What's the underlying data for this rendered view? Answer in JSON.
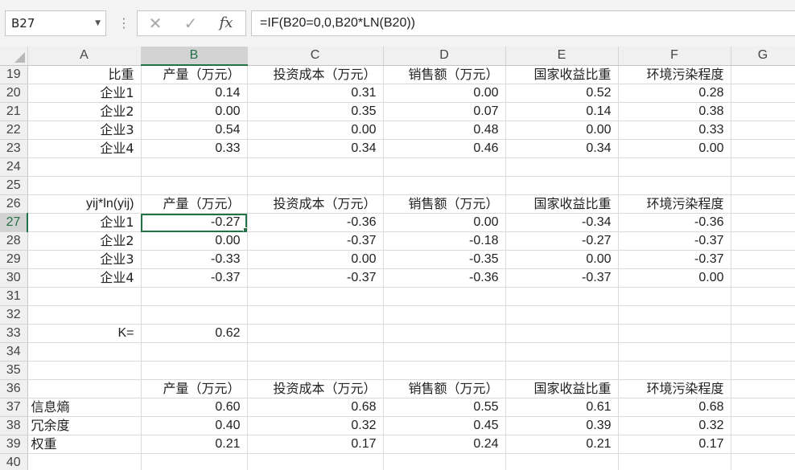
{
  "formula_bar": {
    "name_box": "B27",
    "formula": "=IF(B20=0,0,B20*LN(B20))",
    "cancel_icon": "✕",
    "enter_icon": "✓",
    "fx_label": "fx",
    "dots": "⋮"
  },
  "sheet": {
    "active_cell": "B27",
    "columns": [
      "A",
      "B",
      "C",
      "D",
      "E",
      "F",
      "G"
    ],
    "rows": [
      {
        "num": "19",
        "cells": [
          {
            "v": "比重",
            "a": "t"
          },
          {
            "v": "产量（万元）",
            "a": "t"
          },
          {
            "v": "投资成本（万元）",
            "a": "t"
          },
          {
            "v": "销售额（万元）",
            "a": "t"
          },
          {
            "v": "国家收益比重",
            "a": "t"
          },
          {
            "v": "环境污染程度",
            "a": "t"
          },
          {
            "v": "",
            "a": "e"
          }
        ]
      },
      {
        "num": "20",
        "cells": [
          {
            "v": "企业1",
            "a": "t"
          },
          {
            "v": "0.14",
            "a": "n"
          },
          {
            "v": "0.31",
            "a": "n"
          },
          {
            "v": "0.00",
            "a": "n"
          },
          {
            "v": "0.52",
            "a": "n"
          },
          {
            "v": "0.28",
            "a": "n"
          },
          {
            "v": "",
            "a": "e"
          }
        ]
      },
      {
        "num": "21",
        "cells": [
          {
            "v": "企业2",
            "a": "t"
          },
          {
            "v": "0.00",
            "a": "n"
          },
          {
            "v": "0.35",
            "a": "n"
          },
          {
            "v": "0.07",
            "a": "n"
          },
          {
            "v": "0.14",
            "a": "n"
          },
          {
            "v": "0.38",
            "a": "n"
          },
          {
            "v": "",
            "a": "e"
          }
        ]
      },
      {
        "num": "22",
        "cells": [
          {
            "v": "企业3",
            "a": "t"
          },
          {
            "v": "0.54",
            "a": "n"
          },
          {
            "v": "0.00",
            "a": "n"
          },
          {
            "v": "0.48",
            "a": "n"
          },
          {
            "v": "0.00",
            "a": "n"
          },
          {
            "v": "0.33",
            "a": "n"
          },
          {
            "v": "",
            "a": "e"
          }
        ]
      },
      {
        "num": "23",
        "cells": [
          {
            "v": "企业4",
            "a": "t"
          },
          {
            "v": "0.33",
            "a": "n"
          },
          {
            "v": "0.34",
            "a": "n"
          },
          {
            "v": "0.46",
            "a": "n"
          },
          {
            "v": "0.34",
            "a": "n"
          },
          {
            "v": "0.00",
            "a": "n"
          },
          {
            "v": "",
            "a": "e"
          }
        ]
      },
      {
        "num": "24",
        "cells": [
          {
            "v": "",
            "a": "e"
          },
          {
            "v": "",
            "a": "e"
          },
          {
            "v": "",
            "a": "e"
          },
          {
            "v": "",
            "a": "e"
          },
          {
            "v": "",
            "a": "e"
          },
          {
            "v": "",
            "a": "e"
          },
          {
            "v": "",
            "a": "e"
          }
        ]
      },
      {
        "num": "25",
        "cells": [
          {
            "v": "",
            "a": "e"
          },
          {
            "v": "",
            "a": "e"
          },
          {
            "v": "",
            "a": "e"
          },
          {
            "v": "",
            "a": "e"
          },
          {
            "v": "",
            "a": "e"
          },
          {
            "v": "",
            "a": "e"
          },
          {
            "v": "",
            "a": "e"
          }
        ]
      },
      {
        "num": "26",
        "cells": [
          {
            "v": "yij*ln(yij)",
            "a": "n"
          },
          {
            "v": "产量（万元）",
            "a": "t"
          },
          {
            "v": "投资成本（万元）",
            "a": "t"
          },
          {
            "v": "销售额（万元）",
            "a": "t"
          },
          {
            "v": "国家收益比重",
            "a": "t"
          },
          {
            "v": "环境污染程度",
            "a": "t"
          },
          {
            "v": "",
            "a": "e"
          }
        ]
      },
      {
        "num": "27",
        "cells": [
          {
            "v": "企业1",
            "a": "t"
          },
          {
            "v": "-0.27",
            "a": "n"
          },
          {
            "v": "-0.36",
            "a": "n"
          },
          {
            "v": "0.00",
            "a": "n"
          },
          {
            "v": "-0.34",
            "a": "n"
          },
          {
            "v": "-0.36",
            "a": "n"
          },
          {
            "v": "",
            "a": "e"
          }
        ]
      },
      {
        "num": "28",
        "cells": [
          {
            "v": "企业2",
            "a": "t"
          },
          {
            "v": "0.00",
            "a": "n"
          },
          {
            "v": "-0.37",
            "a": "n"
          },
          {
            "v": "-0.18",
            "a": "n"
          },
          {
            "v": "-0.27",
            "a": "n"
          },
          {
            "v": "-0.37",
            "a": "n"
          },
          {
            "v": "",
            "a": "e"
          }
        ]
      },
      {
        "num": "29",
        "cells": [
          {
            "v": "企业3",
            "a": "t"
          },
          {
            "v": "-0.33",
            "a": "n"
          },
          {
            "v": "0.00",
            "a": "n"
          },
          {
            "v": "-0.35",
            "a": "n"
          },
          {
            "v": "0.00",
            "a": "n"
          },
          {
            "v": "-0.37",
            "a": "n"
          },
          {
            "v": "",
            "a": "e"
          }
        ]
      },
      {
        "num": "30",
        "cells": [
          {
            "v": "企业4",
            "a": "t"
          },
          {
            "v": "-0.37",
            "a": "n"
          },
          {
            "v": "-0.37",
            "a": "n"
          },
          {
            "v": "-0.36",
            "a": "n"
          },
          {
            "v": "-0.37",
            "a": "n"
          },
          {
            "v": "0.00",
            "a": "n"
          },
          {
            "v": "",
            "a": "e"
          }
        ]
      },
      {
        "num": "31",
        "cells": [
          {
            "v": "",
            "a": "e"
          },
          {
            "v": "",
            "a": "e"
          },
          {
            "v": "",
            "a": "e"
          },
          {
            "v": "",
            "a": "e"
          },
          {
            "v": "",
            "a": "e"
          },
          {
            "v": "",
            "a": "e"
          },
          {
            "v": "",
            "a": "e"
          }
        ]
      },
      {
        "num": "32",
        "cells": [
          {
            "v": "",
            "a": "e"
          },
          {
            "v": "",
            "a": "e"
          },
          {
            "v": "",
            "a": "e"
          },
          {
            "v": "",
            "a": "e"
          },
          {
            "v": "",
            "a": "e"
          },
          {
            "v": "",
            "a": "e"
          },
          {
            "v": "",
            "a": "e"
          }
        ]
      },
      {
        "num": "33",
        "cells": [
          {
            "v": "K=",
            "a": "n"
          },
          {
            "v": "0.62",
            "a": "n"
          },
          {
            "v": "",
            "a": "e"
          },
          {
            "v": "",
            "a": "e"
          },
          {
            "v": "",
            "a": "e"
          },
          {
            "v": "",
            "a": "e"
          },
          {
            "v": "",
            "a": "e"
          }
        ]
      },
      {
        "num": "34",
        "cells": [
          {
            "v": "",
            "a": "e"
          },
          {
            "v": "",
            "a": "e"
          },
          {
            "v": "",
            "a": "e"
          },
          {
            "v": "",
            "a": "e"
          },
          {
            "v": "",
            "a": "e"
          },
          {
            "v": "",
            "a": "e"
          },
          {
            "v": "",
            "a": "e"
          }
        ]
      },
      {
        "num": "35",
        "cells": [
          {
            "v": "",
            "a": "e"
          },
          {
            "v": "",
            "a": "e"
          },
          {
            "v": "",
            "a": "e"
          },
          {
            "v": "",
            "a": "e"
          },
          {
            "v": "",
            "a": "e"
          },
          {
            "v": "",
            "a": "e"
          },
          {
            "v": "",
            "a": "e"
          }
        ]
      },
      {
        "num": "36",
        "cells": [
          {
            "v": "",
            "a": "e"
          },
          {
            "v": "产量（万元）",
            "a": "t"
          },
          {
            "v": "投资成本（万元）",
            "a": "t"
          },
          {
            "v": "销售额（万元）",
            "a": "t"
          },
          {
            "v": "国家收益比重",
            "a": "t"
          },
          {
            "v": "环境污染程度",
            "a": "t"
          },
          {
            "v": "",
            "a": "e"
          }
        ]
      },
      {
        "num": "37",
        "cells": [
          {
            "v": "信息熵",
            "a": "l"
          },
          {
            "v": "0.60",
            "a": "n"
          },
          {
            "v": "0.68",
            "a": "n"
          },
          {
            "v": "0.55",
            "a": "n"
          },
          {
            "v": "0.61",
            "a": "n"
          },
          {
            "v": "0.68",
            "a": "n"
          },
          {
            "v": "",
            "a": "e"
          }
        ]
      },
      {
        "num": "38",
        "cells": [
          {
            "v": "冗余度",
            "a": "l"
          },
          {
            "v": "0.40",
            "a": "n"
          },
          {
            "v": "0.32",
            "a": "n"
          },
          {
            "v": "0.45",
            "a": "n"
          },
          {
            "v": "0.39",
            "a": "n"
          },
          {
            "v": "0.32",
            "a": "n"
          },
          {
            "v": "",
            "a": "e"
          }
        ]
      },
      {
        "num": "39",
        "cells": [
          {
            "v": "权重",
            "a": "l"
          },
          {
            "v": "0.21",
            "a": "n"
          },
          {
            "v": "0.17",
            "a": "n"
          },
          {
            "v": "0.24",
            "a": "n"
          },
          {
            "v": "0.21",
            "a": "n"
          },
          {
            "v": "0.17",
            "a": "n"
          },
          {
            "v": "",
            "a": "e"
          }
        ]
      },
      {
        "num": "40",
        "cells": [
          {
            "v": "",
            "a": "e"
          },
          {
            "v": "",
            "a": "e"
          },
          {
            "v": "",
            "a": "e"
          },
          {
            "v": "",
            "a": "e"
          },
          {
            "v": "",
            "a": "e"
          },
          {
            "v": "",
            "a": "e"
          },
          {
            "v": "",
            "a": "e"
          }
        ]
      }
    ]
  },
  "colors": {
    "accent": "#217346",
    "header_bg": "#f0f0f0",
    "selected_header_bg": "#d2d2d2"
  }
}
